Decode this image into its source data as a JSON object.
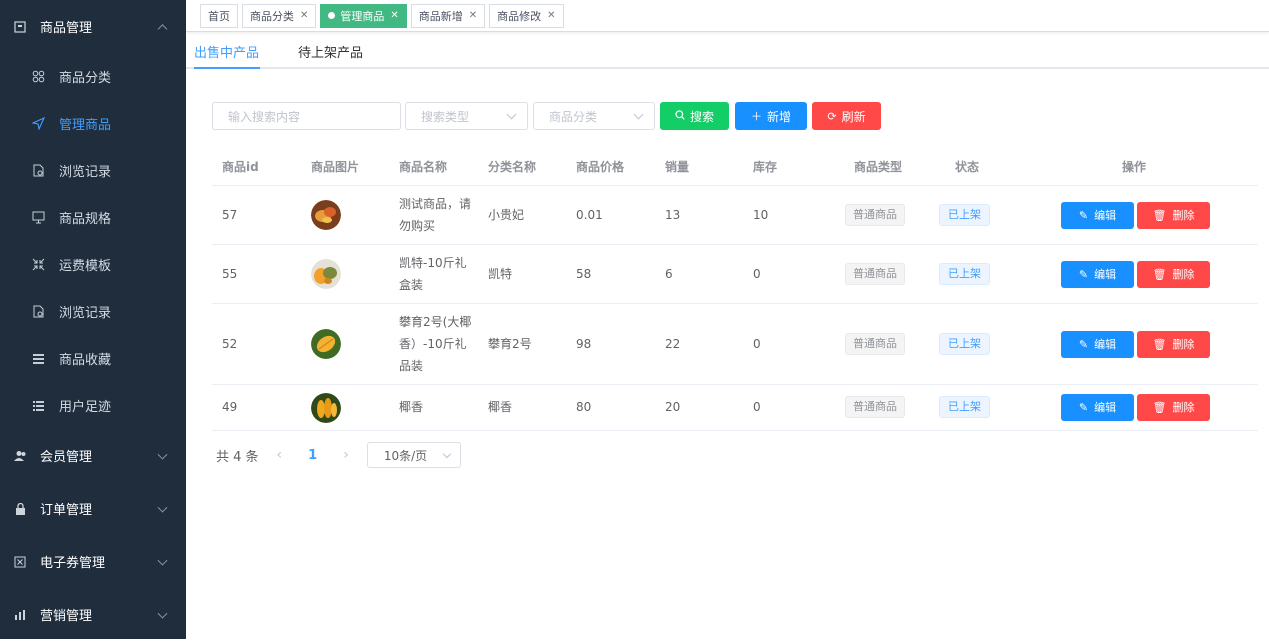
{
  "sidebar": {
    "groups": [
      {
        "label": "商品管理",
        "icon": "box-icon",
        "expanded": true
      },
      {
        "label": "会员管理",
        "icon": "users-icon",
        "expanded": false
      },
      {
        "label": "订单管理",
        "icon": "lock-icon",
        "expanded": false
      },
      {
        "label": "电子券管理",
        "icon": "coupon-icon",
        "expanded": false
      },
      {
        "label": "营销管理",
        "icon": "chart-icon",
        "expanded": false
      }
    ],
    "items": [
      {
        "label": "商品分类",
        "icon": "grid-icon"
      },
      {
        "label": "管理商品",
        "icon": "send-icon",
        "active": true
      },
      {
        "label": "浏览记录",
        "icon": "doc-icon"
      },
      {
        "label": "商品规格",
        "icon": "monitor-icon"
      },
      {
        "label": "运费模板",
        "icon": "shrink-icon"
      },
      {
        "label": "浏览记录",
        "icon": "doc-icon"
      },
      {
        "label": "商品收藏",
        "icon": "menu-icon"
      },
      {
        "label": "用户足迹",
        "icon": "list-icon"
      }
    ]
  },
  "tags": [
    {
      "label": "首页",
      "closable": false
    },
    {
      "label": "商品分类",
      "closable": true
    },
    {
      "label": "管理商品",
      "closable": true,
      "active": true
    },
    {
      "label": "商品新增",
      "closable": true
    },
    {
      "label": "商品修改",
      "closable": true
    }
  ],
  "subtabs": {
    "on_sale": "出售中产品",
    "pending": "待上架产品"
  },
  "filters": {
    "search_placeholder": "输入搜索内容",
    "search_type_placeholder": "搜索类型",
    "category_placeholder": "商品分类",
    "search_btn": "搜索",
    "add_btn": "新增",
    "refresh_btn": "刷新"
  },
  "table": {
    "headers": [
      "商品id",
      "商品图片",
      "商品名称",
      "分类名称",
      "商品价格",
      "销量",
      "库存",
      "商品类型",
      "状态",
      "操作"
    ],
    "rows": [
      {
        "id": "57",
        "name": [
          "测试商品，请",
          "勿购买"
        ],
        "category": "小贵妃",
        "price": "0.01",
        "sales": "13",
        "stock": "10",
        "type": "普通商品",
        "status": "已上架"
      },
      {
        "id": "55",
        "name": [
          "凯特-10斤礼",
          "盒装"
        ],
        "category": "凯特",
        "price": "58",
        "sales": "6",
        "stock": "0",
        "type": "普通商品",
        "status": "已上架"
      },
      {
        "id": "52",
        "name": [
          "攀育2号(大椰",
          "香）-10斤礼",
          "品装"
        ],
        "category": "攀育2号",
        "price": "98",
        "sales": "22",
        "stock": "0",
        "type": "普通商品",
        "status": "已上架"
      },
      {
        "id": "49",
        "name": [
          "椰香"
        ],
        "category": "椰香",
        "price": "80",
        "sales": "20",
        "stock": "0",
        "type": "普通商品",
        "status": "已上架"
      }
    ],
    "edit_label": "编辑",
    "delete_label": "删除"
  },
  "pagination": {
    "total": "共 4 条",
    "page": "1",
    "page_size": "10条/页"
  },
  "colors": {
    "sidebar_bg": "#1f2d3d",
    "accent": "#409eff",
    "success": "#13ce66",
    "danger": "#ff4949",
    "primary": "#1890ff",
    "tag_active": "#42b983"
  }
}
